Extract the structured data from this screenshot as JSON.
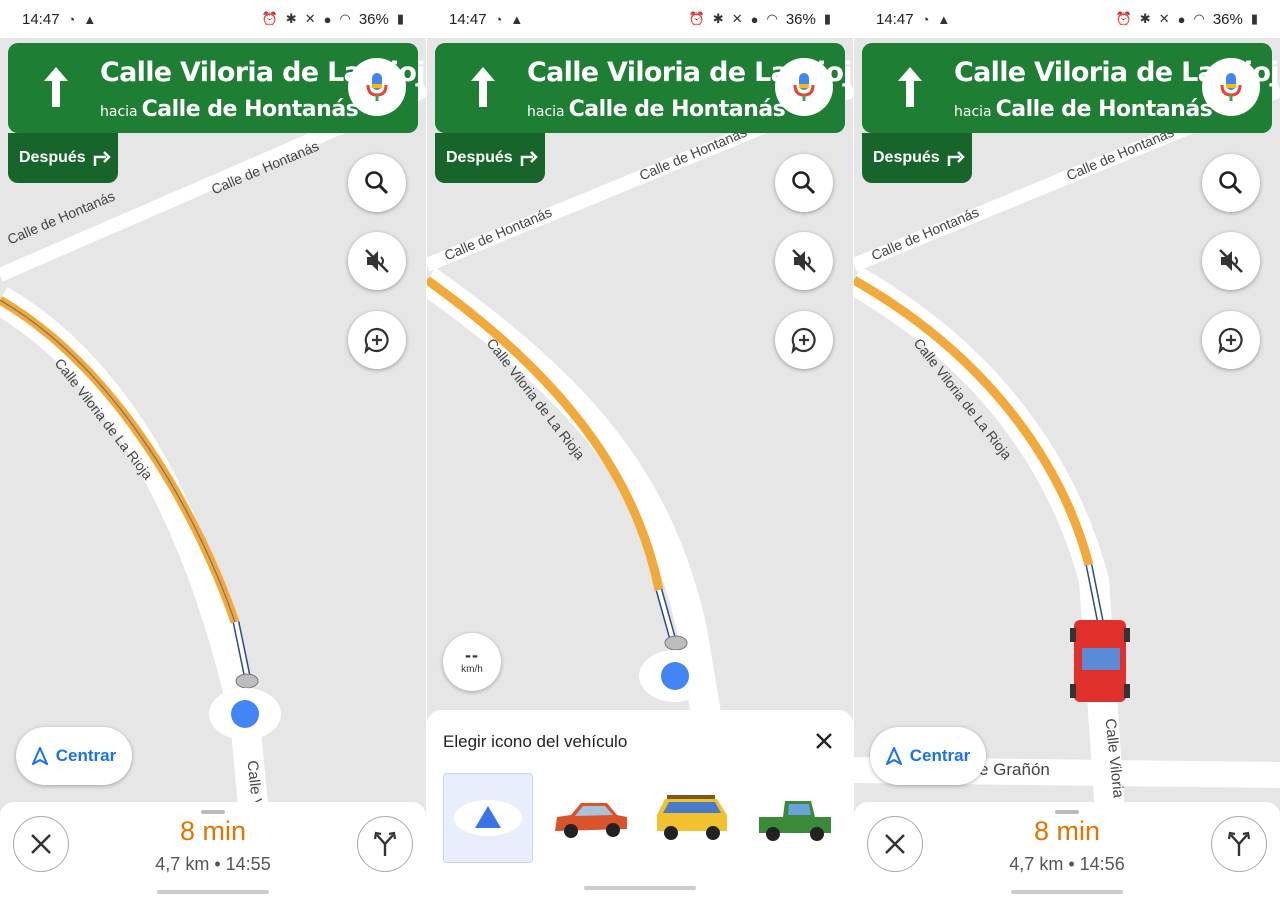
{
  "colors": {
    "banner_green": "#1e7e34",
    "then_green": "#17652a",
    "route_orange": "#f2a93b",
    "eta_orange": "#e37400",
    "accent_blue": "#1a73e8",
    "map_bg": "#e6e6e6"
  },
  "status": {
    "time": "14:47",
    "battery": "36%"
  },
  "nav": {
    "street": "Calle Viloria de La Rioja",
    "toward_prefix": "hacia",
    "toward_street": "Calle de Hontanás",
    "then_label": "Después",
    "direction_icon": "straight-arrow-icon",
    "then_icon": "turn-right-icon"
  },
  "map_labels": {
    "hontanas": "Calle de Hontanás",
    "viloria": "Calle Viloria de La Rioja",
    "viloria_short": "Calle V",
    "viloria_mid": "Calle Viloria",
    "granon": "e Grañón"
  },
  "controls": {
    "centrar": "Centrar",
    "search_icon": "search-icon",
    "mute_icon": "volume-off-icon",
    "report_icon": "add-report-icon",
    "mic_icon": "mic-icon"
  },
  "bottom": {
    "panel1": {
      "eta": "8 min",
      "distance": "4,7 km",
      "arrival": "14:55"
    },
    "panel3": {
      "eta": "8 min",
      "distance": "4,7 km",
      "arrival": "14:56"
    }
  },
  "speedometer": {
    "value": "--",
    "unit": "km/h"
  },
  "vehicle_sheet": {
    "title": "Elegir icono del vehículo",
    "options": [
      "navigation-arrow",
      "red-car",
      "yellow-suv",
      "green-pickup"
    ],
    "selected": "navigation-arrow"
  }
}
